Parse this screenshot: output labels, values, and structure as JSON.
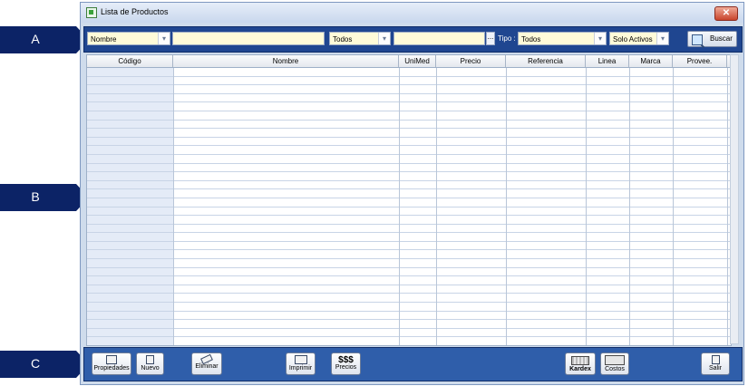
{
  "markers": {
    "a": "A",
    "b": "B",
    "c": "C"
  },
  "window": {
    "title": "Lista de Productos",
    "close_glyph": "✕"
  },
  "filter": {
    "field_select": "Nombre",
    "search_value": "",
    "scope_select": "Todos",
    "second_value": "",
    "ellipsis": "...",
    "tipo_label": "Tipo :",
    "tipo_select": "Todos",
    "status_select": "Solo Activos",
    "search_button": "Buscar"
  },
  "grid": {
    "columns": [
      "Código",
      "Nombre",
      "UniMed",
      "Precio",
      "Referencia",
      "Linea",
      "Marca",
      "Provee."
    ]
  },
  "toolbar": {
    "propiedades": "Propiedades",
    "nuevo": "Nuevo",
    "eliminar": "Eliminar",
    "imprimir": "Imprimir",
    "precios_symbol": "$$$",
    "precios": "Precios",
    "kardex": "Kardex",
    "costos": "Costos",
    "salir": "Salir"
  },
  "icons": {
    "propiedades": "properties-icon",
    "nuevo": "new-document-icon",
    "eliminar": "eraser-icon",
    "imprimir": "printer-icon",
    "kardex": "ledger-icon",
    "costos": "costs-icon",
    "salir": "exit-icon",
    "buscar": "search-icon"
  },
  "colors": {
    "marker": "#0c2366",
    "filter_bar": "#1f4690",
    "toolbar": "#2f5eaa",
    "input_bg": "#fffbd9",
    "code_column": "#e4ebf7"
  }
}
